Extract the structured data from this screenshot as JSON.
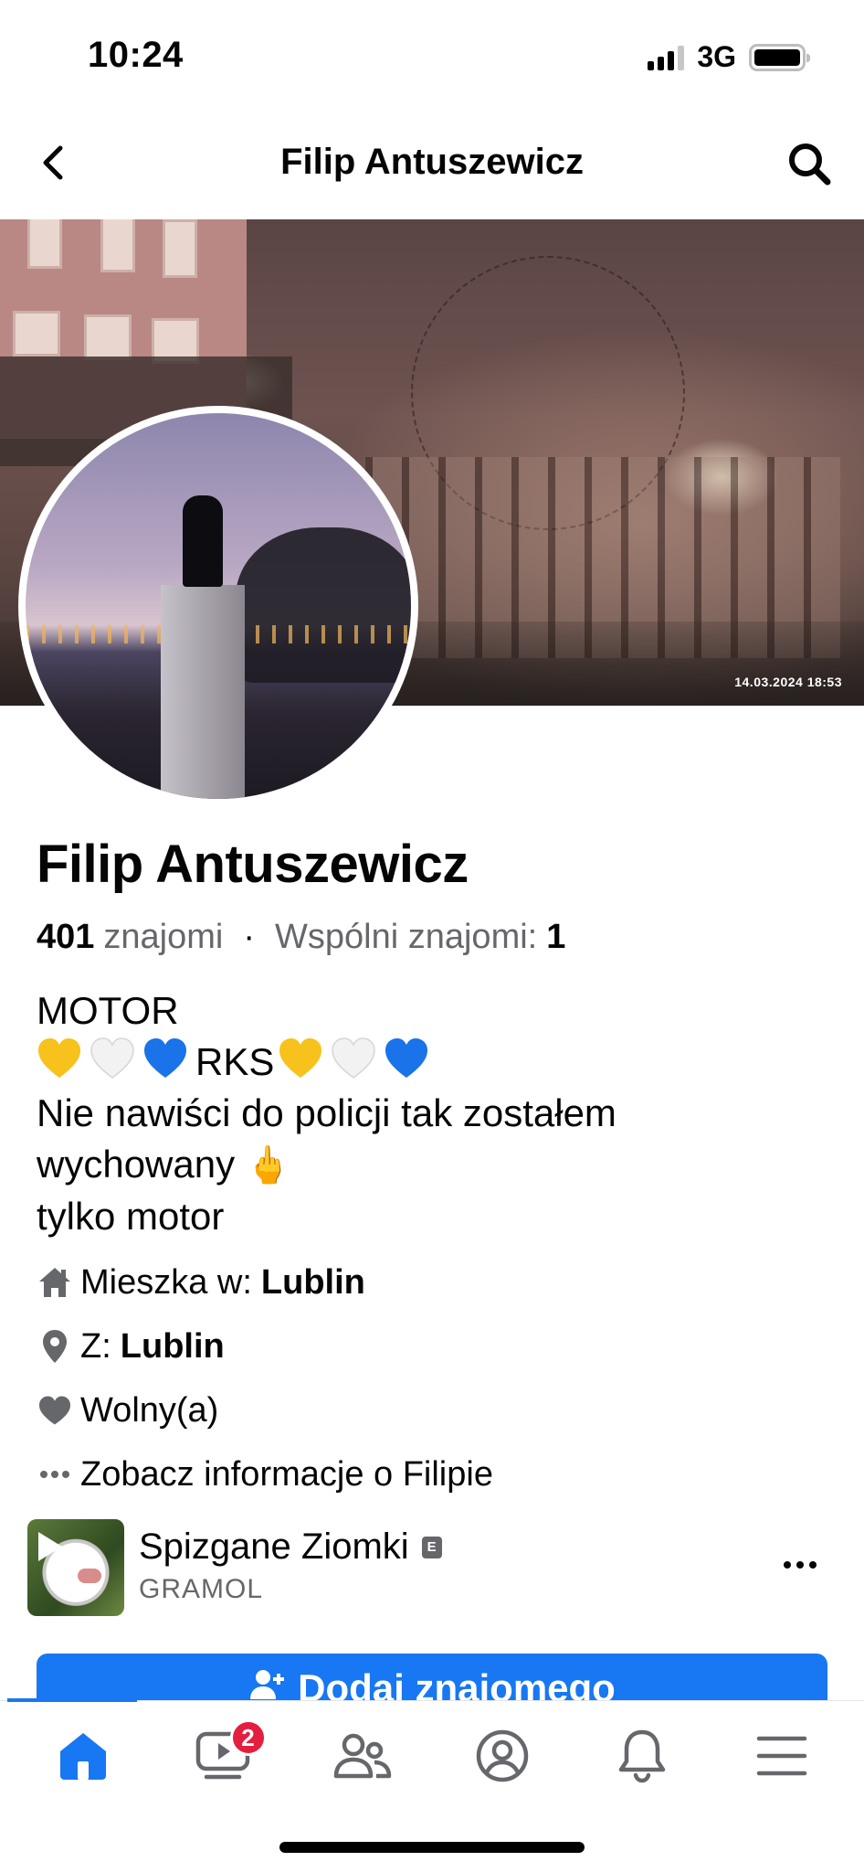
{
  "status_bar": {
    "time": "10:24",
    "network": "3G"
  },
  "header": {
    "title": "Filip Antuszewicz"
  },
  "cover": {
    "timestamp": "14.03.2024 18:53"
  },
  "profile": {
    "name": "Filip Antuszewicz",
    "friends_count": "401",
    "friends_label": "znajomi",
    "separator": "·",
    "mutual_label": "Wspólni znajomi:",
    "mutual_count": "1",
    "bio": {
      "line1": "MOTOR",
      "line2_text": "RKS",
      "line3": "Nie nawiści do policji tak zostałem",
      "line4": "wychowany",
      "line4_emoji": "🖕",
      "line5": "tylko motor"
    }
  },
  "details": {
    "lives_label": "Mieszka w:",
    "lives_value": "Lublin",
    "from_label": "Z:",
    "from_value": "Lublin",
    "relationship": "Wolny(a)",
    "about_link": "Zobacz informacje o Filipie"
  },
  "group": {
    "name": "Spizgane Ziomki",
    "badge": "E",
    "subtitle": "GRAMOL"
  },
  "actions": {
    "add_friend": "Dodaj znajomego"
  },
  "tab_bar": {
    "video_badge": "2",
    "tabs": [
      "home-icon",
      "video-icon",
      "friends-icon",
      "profile-icon",
      "bell-icon",
      "menu-icon"
    ]
  },
  "colors": {
    "accent": "#1877f2",
    "badge": "#e41e3f",
    "secondary_text": "#65676b",
    "heart_yellow": "#f7c21b",
    "heart_white": "#f0f0f0",
    "heart_blue": "#1a73e8"
  }
}
